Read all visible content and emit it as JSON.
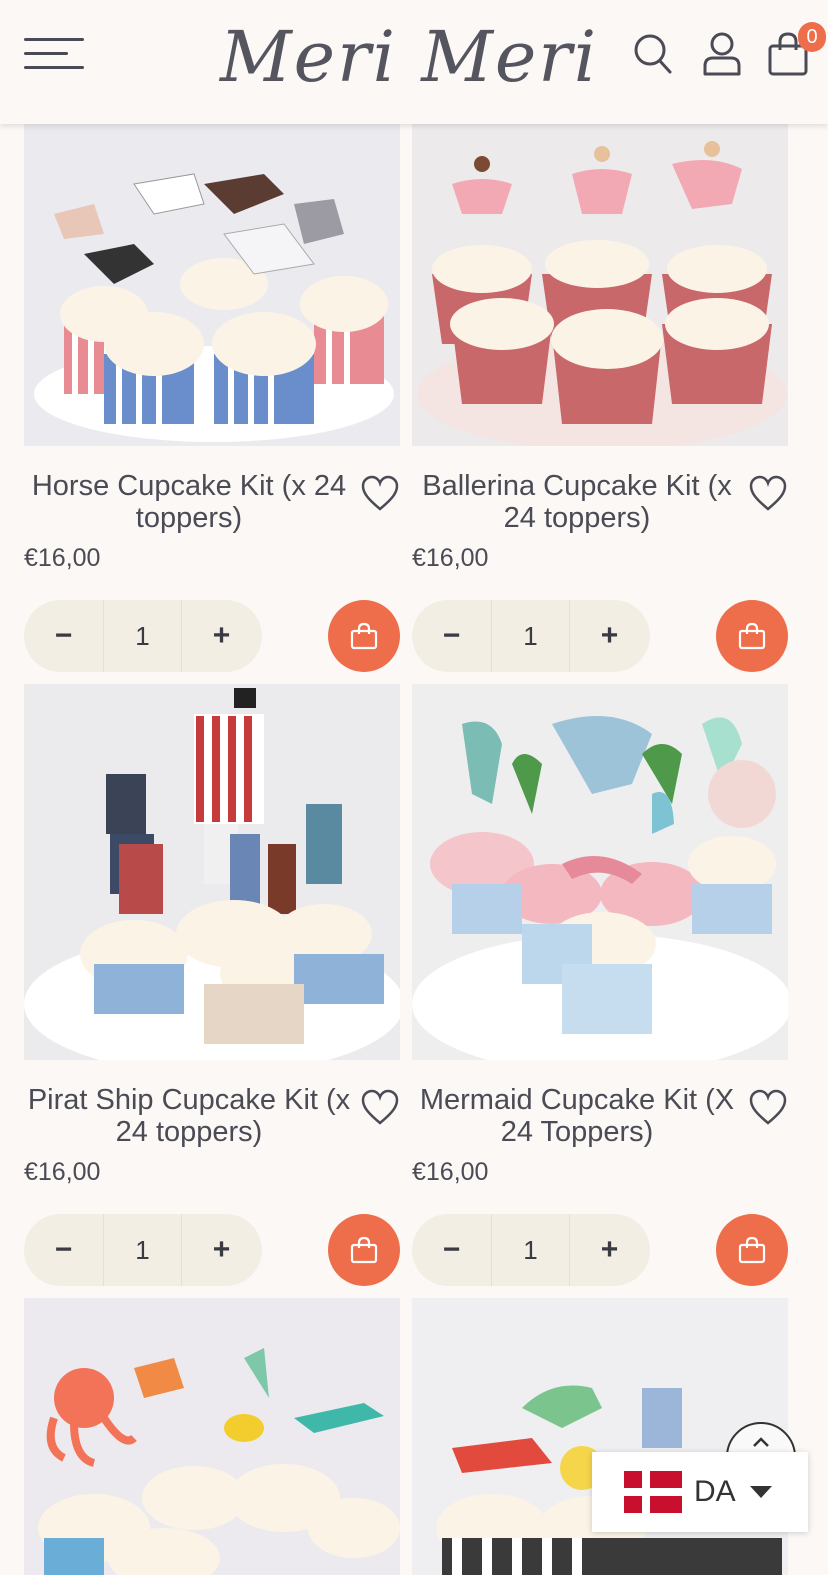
{
  "header": {
    "logo": "Meri Meri",
    "cart_count": "0"
  },
  "products": [
    {
      "title": "Horse Cupcake Kit (x 24 toppers)",
      "price": "€16,00",
      "qty": "1",
      "minus": "−",
      "plus": "+"
    },
    {
      "title": "Ballerina Cupcake Kit (x 24 toppers)",
      "price": "€16,00",
      "qty": "1",
      "minus": "−",
      "plus": "+"
    },
    {
      "title": "Pirat Ship Cupcake Kit (x 24 toppers)",
      "price": "€16,00",
      "qty": "1",
      "minus": "−",
      "plus": "+"
    },
    {
      "title": "Mermaid Cupcake Kit (X 24 Toppers)",
      "price": "€16,00",
      "qty": "1",
      "minus": "−",
      "plus": "+"
    }
  ],
  "language": {
    "code": "DA"
  },
  "colors": {
    "accent": "#ee6e4b",
    "qty_bg": "#f3eee4",
    "text": "#4b4b55",
    "page_bg": "#fcf8f6"
  }
}
